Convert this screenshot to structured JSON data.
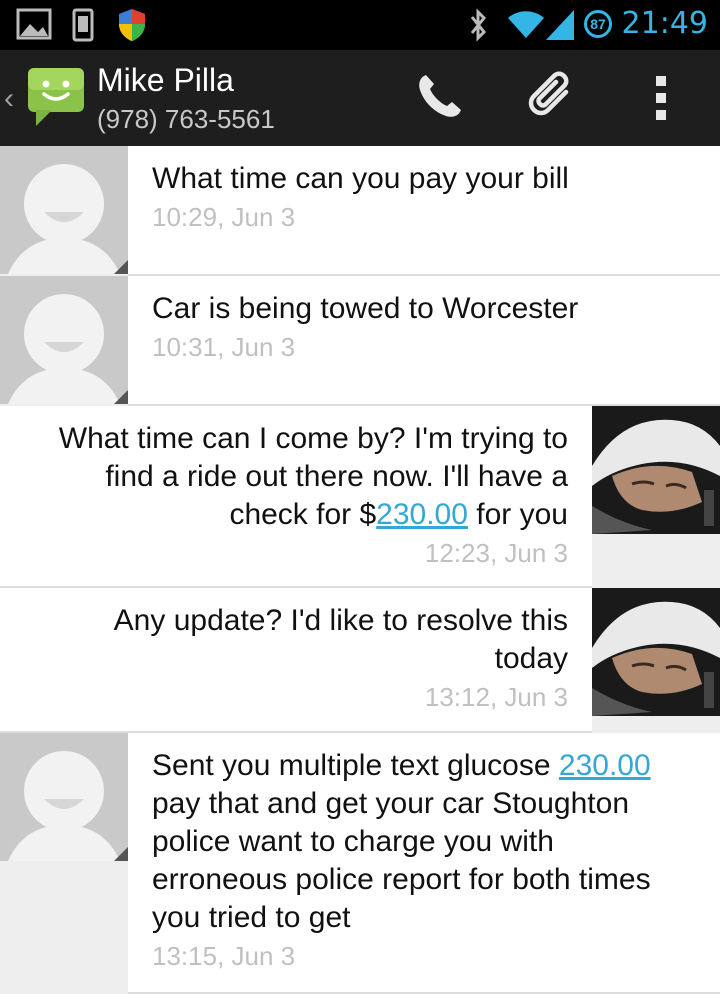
{
  "status_bar": {
    "time": "21:49",
    "battery_level": "87",
    "icons": [
      "picture-icon",
      "phone-outline-icon",
      "shield-icon",
      "bluetooth-icon",
      "wifi-icon",
      "signal-icon"
    ]
  },
  "action_bar": {
    "contact_name": "Mike Pilla",
    "contact_number": "(978) 763-5561",
    "buttons": [
      "call-icon",
      "attach-icon",
      "overflow-menu-icon"
    ]
  },
  "messages": [
    {
      "direction": "received",
      "text": "What time can you pay your bill",
      "time": "10:29, Jun 3"
    },
    {
      "direction": "received",
      "text": "Car is being towed to Worcester",
      "time": "10:31, Jun 3"
    },
    {
      "direction": "sent",
      "text_before": "What time can I come by? I'm trying to find a ride out there now. I'll have a check for $",
      "link": "230.00",
      "text_after": " for you",
      "time": "12:23, Jun 3"
    },
    {
      "direction": "sent",
      "text": "Any update? I'd like to resolve this today",
      "time": "13:12, Jun 3"
    },
    {
      "direction": "received",
      "text_before": "Sent you multiple text glucose ",
      "link": "230.00",
      "text_after": " pay that and get your car Stoughton police want to charge you with erroneous police report for both times you tried to get",
      "time": "13:15, Jun 3"
    }
  ]
}
